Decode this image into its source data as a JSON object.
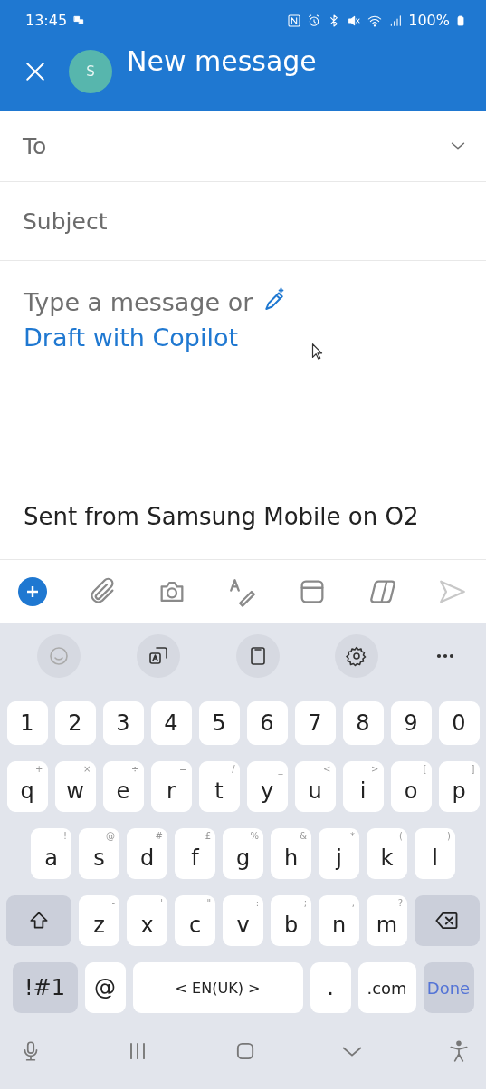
{
  "status_bar": {
    "time": "13:45",
    "battery": "100%"
  },
  "header": {
    "avatar": "S",
    "title": "New message"
  },
  "fields": [
    {
      "placeholder": "To",
      "kind": "dropdown"
    },
    {
      "placeholder": "Subject",
      "kind": "text"
    }
  ],
  "body": {
    "placeholder": "Type a message or",
    "link": "Draft with Copilot",
    "signature": "Sent from Samsung Mobile on O2"
  },
  "keyboard": {
    "number_row": [
      "1",
      "2",
      "3",
      "4",
      "5",
      "6",
      "7",
      "8",
      "9",
      "0"
    ],
    "letter_rows": [
      [
        {
          "key": "q",
          "alt": "+"
        },
        {
          "key": "w",
          "alt": "×"
        },
        {
          "key": "e",
          "alt": "÷"
        },
        {
          "key": "r",
          "alt": "="
        },
        {
          "key": "t",
          "alt": "/"
        },
        {
          "key": "y",
          "alt": "_"
        },
        {
          "key": "u",
          "alt": "<"
        },
        {
          "key": "i",
          "alt": ">"
        },
        {
          "key": "o",
          "alt": "["
        },
        {
          "key": "p",
          "alt": "]"
        }
      ],
      [
        {
          "key": "a",
          "alt": "!"
        },
        {
          "key": "s",
          "alt": "@"
        },
        {
          "key": "d",
          "alt": "#"
        },
        {
          "key": "f",
          "alt": "£"
        },
        {
          "key": "g",
          "alt": "%"
        },
        {
          "key": "h",
          "alt": "&"
        },
        {
          "key": "j",
          "alt": "*"
        },
        {
          "key": "k",
          "alt": "("
        },
        {
          "key": "l",
          "alt": ")"
        }
      ],
      [
        {
          "key": "z",
          "alt": "-"
        },
        {
          "key": "x",
          "alt": "'"
        },
        {
          "key": "c",
          "alt": "\""
        },
        {
          "key": "v",
          "alt": ":"
        },
        {
          "key": "b",
          "alt": ";"
        },
        {
          "key": "n",
          "alt": ","
        },
        {
          "key": "m",
          "alt": "?"
        }
      ]
    ],
    "bottom_row": [
      {
        "kind": "symbols",
        "label": "!#1"
      },
      {
        "kind": "char",
        "label": "@"
      },
      {
        "kind": "space",
        "label": "EN(UK)",
        "prev": "<",
        "next": ">"
      },
      {
        "kind": "char",
        "label": "."
      },
      {
        "kind": "domain",
        "label": ".com"
      },
      {
        "kind": "action",
        "label": "Done"
      }
    ]
  }
}
